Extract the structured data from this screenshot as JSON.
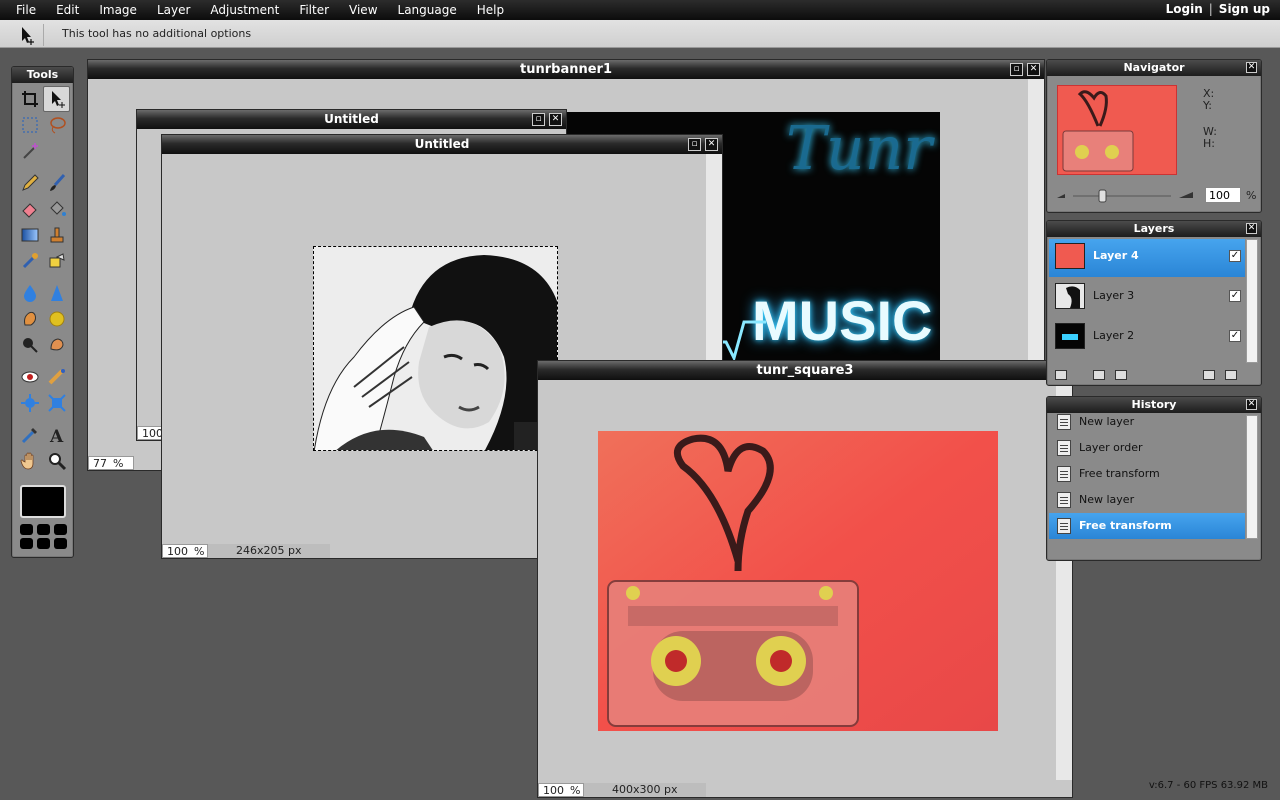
{
  "menu": {
    "items": [
      "File",
      "Edit",
      "Image",
      "Layer",
      "Adjustment",
      "Filter",
      "View",
      "Language",
      "Help"
    ],
    "login": "Login",
    "separator": "|",
    "signup": "Sign up"
  },
  "options_bar": {
    "message": "This tool has no additional options"
  },
  "tools": {
    "title": "Tools"
  },
  "windows": {
    "banner": {
      "title": "tunrbanner1",
      "zoom": "77",
      "unit": "%",
      "text_tunr": "Tunr",
      "text_music": "MUSIC"
    },
    "untitled_back": {
      "title": "Untitled",
      "zoom": "100"
    },
    "untitled_front": {
      "title": "Untitled",
      "zoom": "100",
      "unit": "%",
      "size": "246x205 px"
    },
    "square": {
      "title": "tunr_square3",
      "zoom": "100",
      "unit": "%",
      "size": "400x300 px"
    }
  },
  "navigator": {
    "title": "Navigator",
    "x_label": "X:",
    "y_label": "Y:",
    "w_label": "W:",
    "h_label": "H:",
    "zoom_value": "100",
    "zoom_unit": "%"
  },
  "layers": {
    "title": "Layers",
    "items": [
      {
        "name": "Layer 4",
        "selected": true,
        "visible": true
      },
      {
        "name": "Layer 3",
        "selected": false,
        "visible": true
      },
      {
        "name": "Layer 2",
        "selected": false,
        "visible": true
      }
    ]
  },
  "history": {
    "title": "History",
    "items": [
      "New layer",
      "Layer order",
      "Free transform",
      "New layer",
      "Free transform"
    ],
    "selected_index": 4
  },
  "status": {
    "version": "v:6.7 - 60 FPS 63.92 MB"
  },
  "colors": {
    "accent": "#2f8ee0",
    "foreground": "#000000",
    "workspace": "#585858"
  }
}
